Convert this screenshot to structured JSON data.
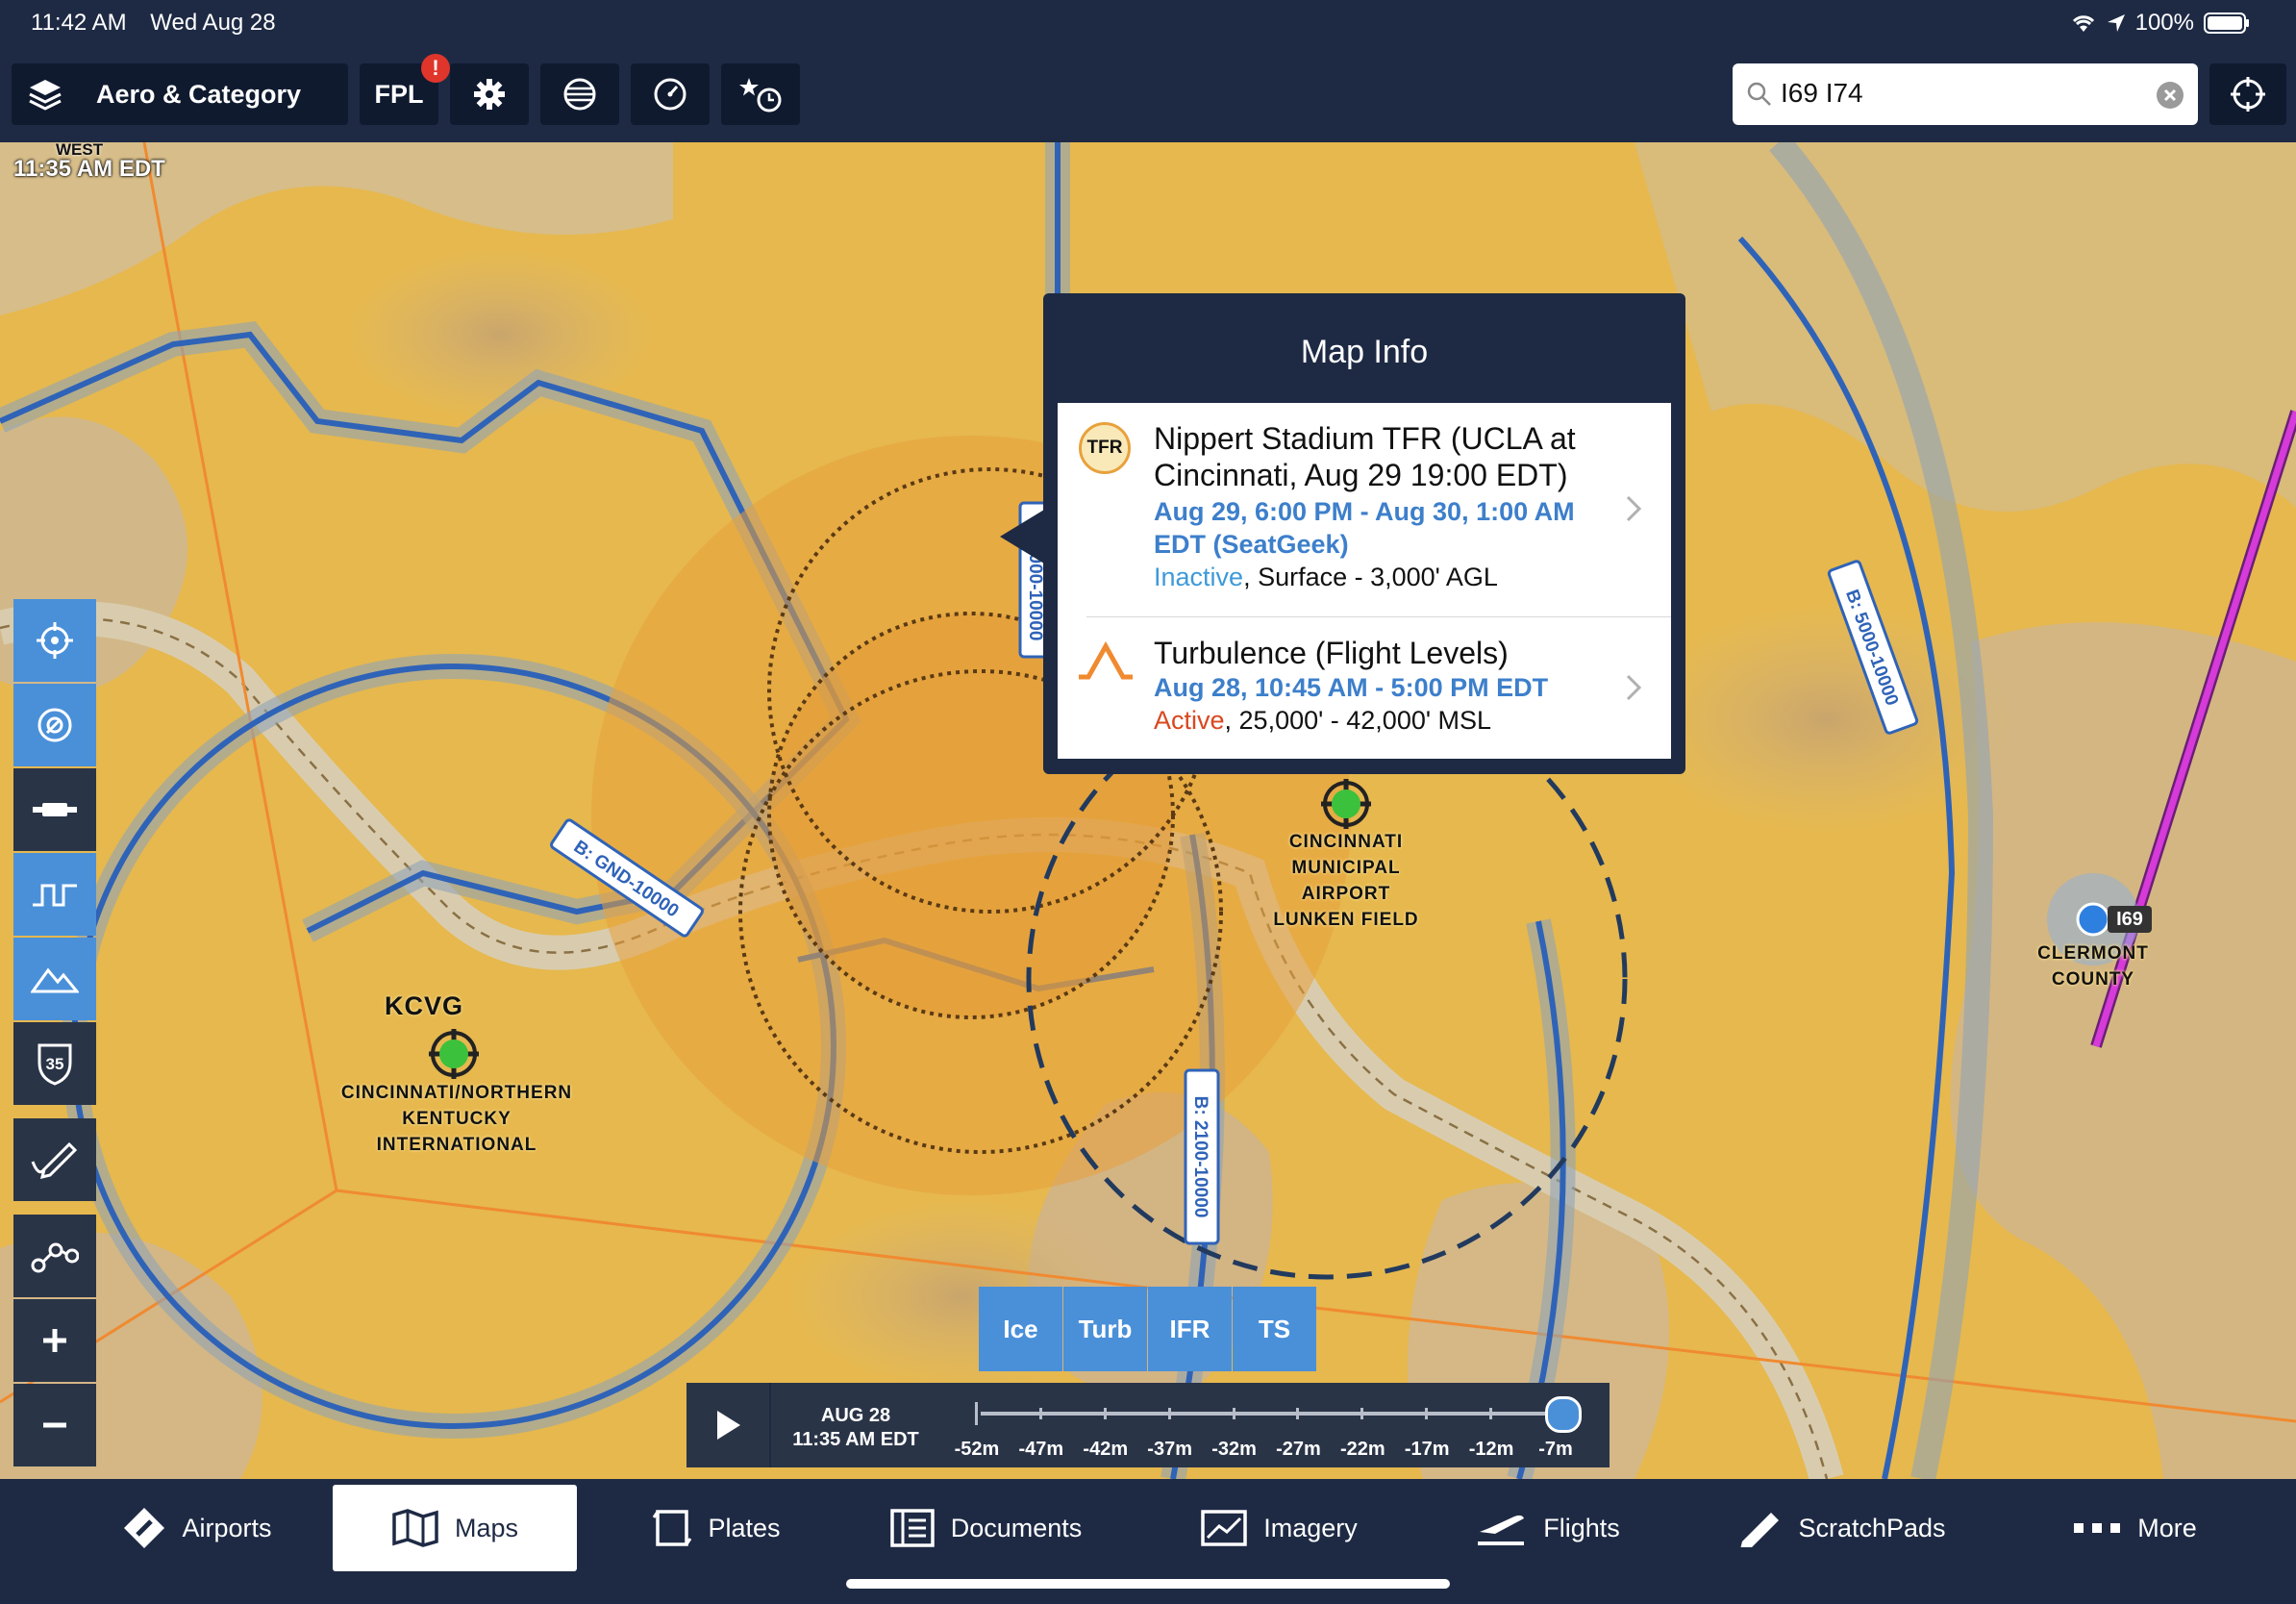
{
  "status": {
    "time": "11:42 AM",
    "date": "Wed Aug 28",
    "battery": "100%"
  },
  "toolbar": {
    "layers_label": "Aero & Category",
    "fpl_label": "FPL",
    "badge": "!",
    "search_value": "I69 I74"
  },
  "map": {
    "time_zone": "WEST",
    "time_label": "11:35 AM EDT",
    "airspace_labels": [
      "B: GND-10000",
      "B: 3000-10000",
      "B: 5000-10000",
      "B: 2100-10000"
    ],
    "airports": [
      {
        "code": "KCVG",
        "name_lines": [
          "CINCINNATI/NORTHERN",
          "KENTUCKY",
          "INTERNATIONAL"
        ]
      },
      {
        "code": "",
        "name_lines": [
          "CINCINNATI",
          "MUNICIPAL",
          "AIRPORT",
          "LUNKEN FIELD"
        ]
      },
      {
        "code": "I69",
        "name_lines": [
          "CLERMONT",
          "COUNTY"
        ]
      }
    ]
  },
  "popup": {
    "title": "Map Info",
    "items": [
      {
        "icon_text": "TFR",
        "title": "Nippert Stadium TFR (UCLA at Cincinnati, Aug 29 19:00 EDT)",
        "time": "Aug 29, 6:00 PM - Aug 30, 1:00 AM EDT (SeatGeek)",
        "status": "Inactive",
        "detail": ", Surface - 3,000' AGL",
        "status_color": "#3d9ad9"
      },
      {
        "icon_text": "",
        "title": "Turbulence (Flight Levels)",
        "time": "Aug 28, 10:45 AM - 5:00 PM EDT",
        "status": "Active",
        "detail": ", 25,000' - 42,000' MSL",
        "status_color": "#d9481f"
      }
    ]
  },
  "weather_buttons": [
    "Ice",
    "Turb",
    "IFR",
    "TS"
  ],
  "sidebar": {
    "speed_badge": "35"
  },
  "timeline": {
    "date": "AUG 28",
    "time": "11:35 AM EDT",
    "ticks": [
      "-52m",
      "-47m",
      "-42m",
      "-37m",
      "-32m",
      "-27m",
      "-22m",
      "-17m",
      "-12m",
      "-7m"
    ]
  },
  "tabs": [
    "Airports",
    "Maps",
    "Plates",
    "Documents",
    "Imagery",
    "Flights",
    "ScratchPads",
    "More"
  ],
  "colors": {
    "accent": "#4a90d9",
    "nav": "#1e2a44",
    "map_fill": "#e6b84e",
    "airspace": "#2f63b8",
    "route": "#d63ad8",
    "alert": "#e0352b"
  }
}
